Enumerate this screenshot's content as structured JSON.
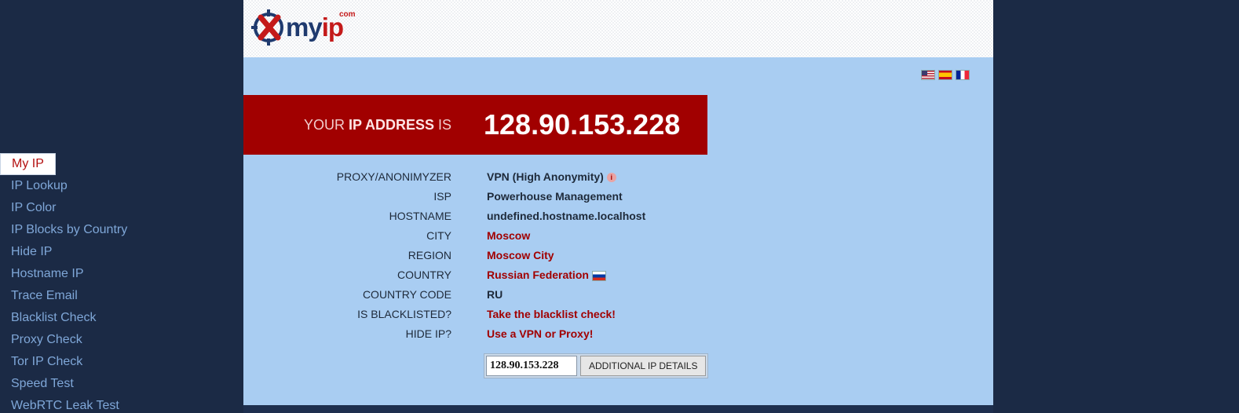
{
  "brand": {
    "logo_my": "my",
    "logo_ip": "ip",
    "logo_com": "com",
    "colors": {
      "navy": "#1f3a6e",
      "red": "#c41a1a"
    }
  },
  "nav": {
    "items": [
      {
        "label": "My IP",
        "active": true
      },
      {
        "label": "IP Lookup"
      },
      {
        "label": "IP Color"
      },
      {
        "label": "IP Blocks by Country"
      },
      {
        "label": "Hide IP"
      },
      {
        "label": "Hostname IP"
      },
      {
        "label": "Trace Email"
      },
      {
        "label": "Blacklist Check"
      },
      {
        "label": "Proxy Check"
      },
      {
        "label": "Tor IP Check"
      },
      {
        "label": "Speed Test"
      },
      {
        "label": "WebRTC Leak Test"
      }
    ]
  },
  "languages": [
    "us-flag-icon",
    "es-flag-icon",
    "fr-flag-icon"
  ],
  "banner": {
    "label_pre": "YOUR ",
    "label_bold": "IP ADDRESS",
    "label_post": " IS",
    "ip": "128.90.153.228"
  },
  "details": {
    "rows": [
      {
        "key": "PROXY/ANONIMYZER",
        "value": "VPN (High Anonymity)"
      },
      {
        "key": "ISP",
        "value": "Powerhouse Management"
      },
      {
        "key": "HOSTNAME",
        "value": "undefined.hostname.localhost"
      },
      {
        "key": "CITY",
        "value": "Moscow"
      },
      {
        "key": "REGION",
        "value": "Moscow City"
      },
      {
        "key": "COUNTRY",
        "value": "Russian Federation"
      },
      {
        "key": "COUNTRY CODE",
        "value": "RU"
      },
      {
        "key": "IS BLACKLISTED?",
        "value": "Take the blacklist check!"
      },
      {
        "key": "HIDE IP?",
        "value": "Use a VPN or Proxy!"
      }
    ],
    "info_icon": "i"
  },
  "lookup": {
    "input_value": "128.90.153.228",
    "button_label": "ADDITIONAL IP DETAILS"
  }
}
